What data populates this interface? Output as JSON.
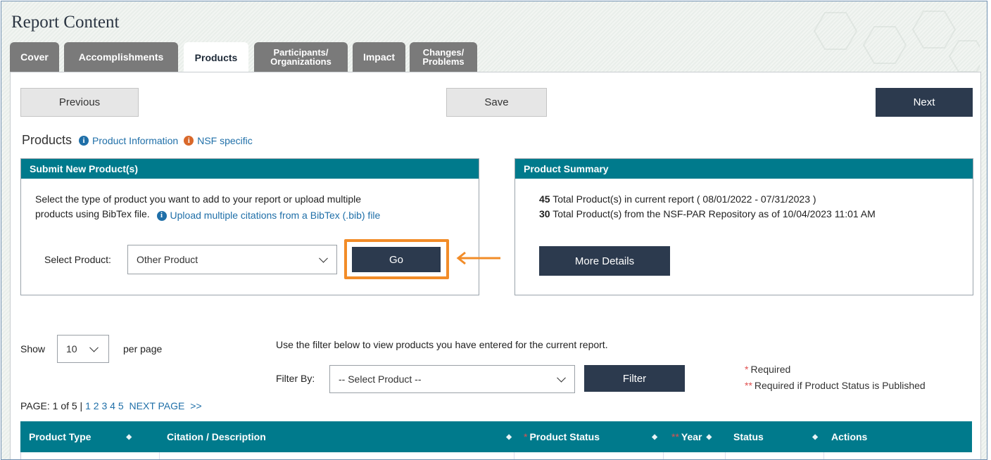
{
  "header": {
    "title": "Report Content"
  },
  "tabs": [
    {
      "label": "Cover"
    },
    {
      "label": "Accomplishments"
    },
    {
      "label": "Products"
    },
    {
      "line1": "Participants/",
      "line2": "Organizations"
    },
    {
      "label": "Impact"
    },
    {
      "line1": "Changes/",
      "line2": "Problems"
    }
  ],
  "toolbar": {
    "previous": "Previous",
    "save": "Save",
    "next": "Next"
  },
  "products": {
    "heading": "Products",
    "product_info_link": "Product Information",
    "nsf_specific_link": "NSF specific"
  },
  "submit_box": {
    "title": "Submit New Product(s)",
    "description_line1": "Select the type of product you want to add to your report or upload multiple",
    "description_line2": "products using BibTex file.",
    "upload_link": "Upload multiple citations from a BibTex (.bib) file",
    "select_label": "Select Product:",
    "select_value": "Other Product",
    "go_button": "Go"
  },
  "summary_box": {
    "title": "Product Summary",
    "line1_count": "45",
    "line1_text": "Total Product(s) in current report ( 08/01/2022 - 07/31/2023 )",
    "line2_count": "30",
    "line2_text": "Total Product(s) from the NSF-PAR Repository as of 10/04/2023 11:01 AM",
    "more_details": "More Details"
  },
  "list_controls": {
    "show_label": "Show",
    "per_page_value": "10",
    "per_page_label": "per page",
    "filter_hint": "Use the filter below to view products you have entered for the current report.",
    "filter_by_label": "Filter By:",
    "filter_select_value": "-- Select Product --",
    "filter_button": "Filter",
    "required_note": "Required",
    "required_published_note": "Required if Product Status is Published",
    "required_marker": "*",
    "required_published_marker": "**"
  },
  "pagination": {
    "page_info": "PAGE: 1 of 5 |",
    "pages": [
      "1",
      "2",
      "3",
      "4",
      "5"
    ],
    "next_page": "NEXT PAGE",
    "next_arrows": ">>"
  },
  "table": {
    "columns": [
      {
        "label": "Product Type",
        "marker": ""
      },
      {
        "label": "Citation / Description",
        "marker": ""
      },
      {
        "label": "Product Status",
        "marker": "*"
      },
      {
        "label": "Year",
        "marker": "**"
      },
      {
        "label": "Status",
        "marker": ""
      },
      {
        "label": "Actions",
        "marker": ""
      }
    ]
  },
  "colors": {
    "teal_header": "#007a8c",
    "dark_button": "#2c3a4e",
    "link_blue": "#1f6fa8",
    "highlight_orange": "#f28c28"
  },
  "icons": [
    "info-icon",
    "chevron-down-icon",
    "sort-icon",
    "arrow-left-icon"
  ]
}
